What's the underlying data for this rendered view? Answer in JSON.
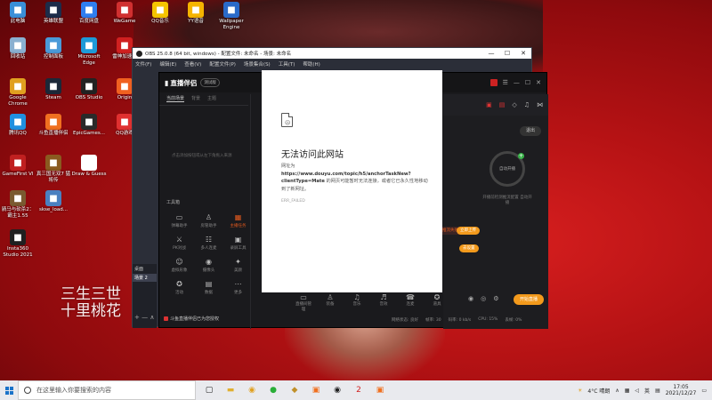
{
  "desktop_icons": [
    {
      "label": "此电脑",
      "icon": "computer-icon",
      "color": "#3a8fd8"
    },
    {
      "label": "英雄联盟",
      "icon": "lol-icon",
      "color": "#1d2c4a"
    },
    {
      "label": "百度网盘",
      "icon": "baidu-netdisk-icon",
      "color": "#2f7ef0"
    },
    {
      "label": "WeGame",
      "icon": "wegame-icon",
      "color": "#d03030"
    },
    {
      "label": "QQ音乐",
      "icon": "qqmusic-icon",
      "color": "#f5c400"
    },
    {
      "label": "YY语音",
      "icon": "yy-icon",
      "color": "#f5b400"
    },
    {
      "label": "Wallpaper Engine",
      "icon": "wallpaper-engine-icon",
      "color": "#2a6ac9"
    },
    {
      "label": "回收站",
      "icon": "recycle-bin-icon",
      "color": "#8ab0d0"
    },
    {
      "label": "控制面板",
      "icon": "control-panel-icon",
      "color": "#4a9ad8"
    },
    {
      "label": "Microsoft Edge",
      "icon": "edge-icon",
      "color": "#1e9ad8"
    },
    {
      "label": "雷神加速器",
      "icon": "leishen-icon",
      "color": "#d02020"
    },
    {
      "label": "Google Chrome",
      "icon": "chrome-icon",
      "color": "#e0a020"
    },
    {
      "label": "Steam",
      "icon": "steam-icon",
      "color": "#1b2838"
    },
    {
      "label": "OBS Studio",
      "icon": "obs-icon",
      "color": "#222222"
    },
    {
      "label": "Origin",
      "icon": "origin-icon",
      "color": "#f06020"
    },
    {
      "label": "腾讯QQ",
      "icon": "qq-icon",
      "color": "#2090e0"
    },
    {
      "label": "斗鱼直播伴侣",
      "icon": "douyu-icon",
      "color": "#f07020"
    },
    {
      "label": "EpicGames...",
      "icon": "epic-icon",
      "color": "#2a2a2a"
    },
    {
      "label": "QQ游戏",
      "icon": "qqgame-icon",
      "color": "#e03030"
    },
    {
      "label": "GameFirst VI",
      "icon": "gamefirst-icon",
      "color": "#c02020"
    },
    {
      "label": "真三国无双7 猛将传",
      "icon": "dynasty-warriors-icon",
      "color": "#8a5a20"
    },
    {
      "label": "Draw & Guess",
      "icon": "draw-guess-icon",
      "color": "#ffffff"
    },
    {
      "label": "骑马与砍杀2：霸主1.55",
      "icon": "bannerlord-icon",
      "color": "#7a5a30"
    },
    {
      "label": "skse_load...",
      "icon": "skse-icon",
      "color": "#4a80c0"
    },
    {
      "label": "Insta360 Studio 2021",
      "icon": "insta360-icon",
      "color": "#202020"
    }
  ],
  "wallpaper_text": "三生三世十里桃花",
  "obs": {
    "title": "OBS 25.0.8 (64 bit, windows) - 配置文件: 未命名 - 场景: 未命名",
    "menu": [
      "文件(F)",
      "编辑(E)",
      "查看(V)",
      "配置文件(P)",
      "场景集合(S)",
      "工具(T)",
      "帮助(H)"
    ],
    "scenes_header": "场景",
    "scene_item": "场景 2",
    "desktop_label": "桌面"
  },
  "zhibo": {
    "brand": "直播伴侣",
    "badge": "测试版",
    "tabs": [
      "当前场景",
      "背景",
      "主题"
    ],
    "empty_hint": "点击添加按钮或从左下角拖入来源",
    "tools_title": "工具箱",
    "tools": [
      "弹幕助手",
      "房管助手",
      "主播任务",
      "PK对战",
      "多人连麦",
      "录屏工具",
      "虚拟形象",
      "摄像头",
      "美颜",
      "活动",
      "数据",
      "更多"
    ],
    "exit_btn": "退出",
    "ring_label": "自动开播",
    "ring_note": "开播前检测推流配置 自动开播",
    "orange1": "立即上传",
    "orange2": "去设置",
    "err_pill": "推流失败",
    "bottom_tools": [
      "直播间管理",
      "装备",
      "音乐",
      "音效",
      "连麦",
      "道具"
    ],
    "start_btn": "开始直播",
    "status": [
      "网络状态: 良好",
      "帧率: 30",
      "码率: 0 kb/s",
      "CPU: 15%",
      "丢帧: 0%"
    ],
    "bottom_left": "斗鱼直播伴侣已为您授权"
  },
  "dialog": {
    "title": "无法访问此网站",
    "line1": "网址为",
    "url": "https://www.douyu.com/topic/h5/anchorTaskNew?clientType=Mate",
    "body": "的网页可能暂时无法连接，或者它已永久性地移动到了新网址。",
    "code": "ERR_FAILED"
  },
  "taskbar": {
    "search_placeholder": "在这里输入你要搜索的内容",
    "weather": "4°C 晴朗",
    "lang": "英",
    "time": "17:05",
    "date": "2021/12/27"
  }
}
